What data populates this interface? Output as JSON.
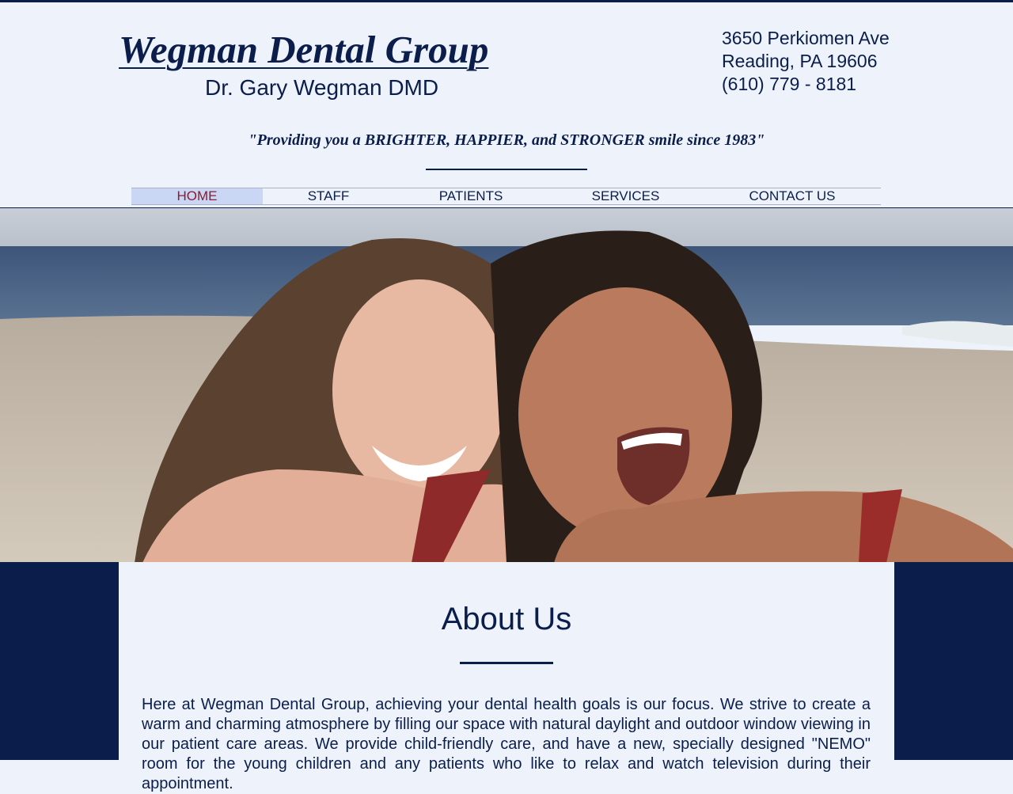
{
  "header": {
    "brand_title": "Wegman Dental Group",
    "brand_subtitle": "Dr. Gary Wegman DMD",
    "address_line1": "3650 Perkiomen Ave",
    "address_line2": "Reading, PA 19606",
    "phone": "(610) 779 - 8181",
    "tagline": "\"Providing you a BRIGHTER, HAPPIER, and STRONGER smile since 1983\""
  },
  "nav": {
    "items": [
      {
        "label": "HOME",
        "active": true
      },
      {
        "label": "STAFF",
        "active": false
      },
      {
        "label": "PATIENTS",
        "active": false
      },
      {
        "label": "SERVICES",
        "active": false
      },
      {
        "label": "CONTACT US",
        "active": false
      }
    ]
  },
  "hero": {
    "image_subject": "two smiling women on a beach"
  },
  "about": {
    "title": "About Us",
    "body": "Here at Wegman Dental Group, achieving your dental health goals is our focus. We strive to create a warm and charming atmosphere by filling our space with natural daylight and outdoor window viewing in our patient care areas. We provide child-friendly care, and have a new, specially designed \"NEMO\" room for the young children and any patients who like to relax and watch television during their appointment."
  },
  "colors": {
    "navy": "#0B1E4B",
    "page_bg": "#EEF3FB",
    "nav_active_bg": "#C9D7F5",
    "nav_active_text": "#8A1C2B"
  }
}
